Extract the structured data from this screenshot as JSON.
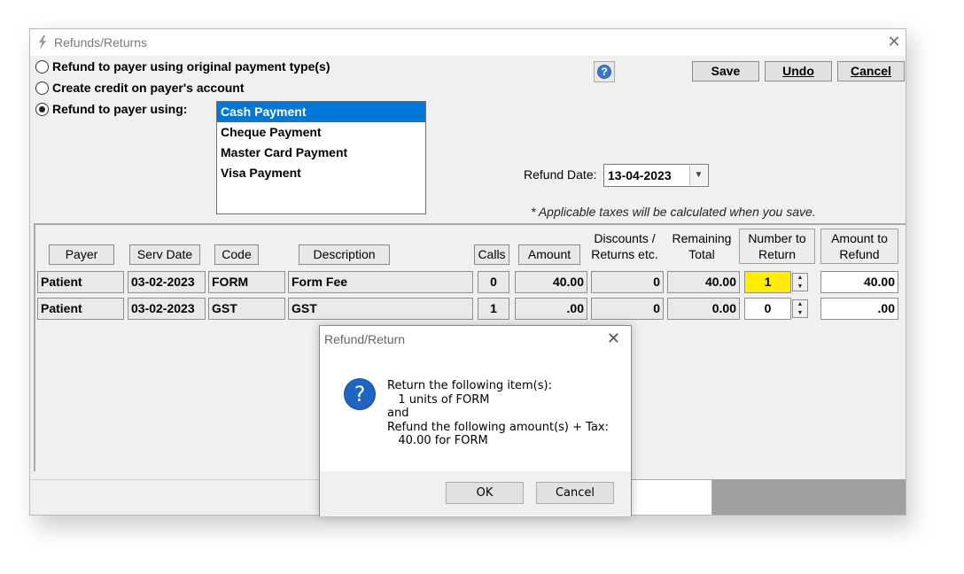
{
  "window": {
    "title": "Refunds/Returns",
    "close_glyph": "✕"
  },
  "options": {
    "original": "Refund to payer using original payment type(s)",
    "credit": "Create credit on payer's account",
    "using": "Refund to payer using:",
    "selected": "using"
  },
  "payment_types": [
    "Cash Payment",
    "Cheque Payment",
    "Master Card Payment",
    "Visa Payment"
  ],
  "selected_payment": "Cash Payment",
  "toolbar": {
    "help": "?",
    "save": "Save",
    "undo": "Undo",
    "cancel": "Cancel"
  },
  "refund_date": {
    "label": "Refund Date:",
    "value": "13-04-2023"
  },
  "tax_note": "* Applicable taxes will be calculated when you save.",
  "grid": {
    "headers": {
      "payer": "Payer",
      "serv_date": "Serv Date",
      "code": "Code",
      "description": "Description",
      "calls": "Calls",
      "amount": "Amount",
      "discounts_1": "Discounts /",
      "discounts_2": "Returns etc.",
      "remaining_1": "Remaining",
      "remaining_2": "Total",
      "number_1": "Number to",
      "number_2": "Return",
      "refund_1": "Amount to",
      "refund_2": "Refund"
    },
    "rows": [
      {
        "payer": "Patient",
        "serv_date": "03-02-2023",
        "code": "FORM",
        "description": "Form Fee",
        "calls": "0",
        "amount": "40.00",
        "discounts": "0",
        "remaining": "40.00",
        "number": "1",
        "refund": "40.00"
      },
      {
        "payer": "Patient",
        "serv_date": "03-02-2023",
        "code": "GST",
        "description": "GST",
        "calls": "1",
        "amount": ".00",
        "discounts": "0",
        "remaining": "0.00",
        "number": "0",
        "refund": ".00"
      }
    ]
  },
  "dialog": {
    "title": "Refund/Return",
    "icon": "?",
    "line1": "Return the following item(s):",
    "line2": "   1 units of FORM",
    "line3": "and",
    "line4": "Refund the following amount(s) + Tax:",
    "line5": "   40.00 for FORM",
    "ok": "OK",
    "cancel": "Cancel",
    "close_glyph": "✕"
  },
  "colors": {
    "selection": "#0078d7",
    "highlight": "#ffee00",
    "question_icon": "#1f64c2"
  },
  "icons": {
    "app": "app-lightning-icon",
    "help": "help-question-icon",
    "dialog": "question-icon",
    "dropdown": "chevron-down-icon",
    "spinner": "spinner-arrows-icon"
  }
}
